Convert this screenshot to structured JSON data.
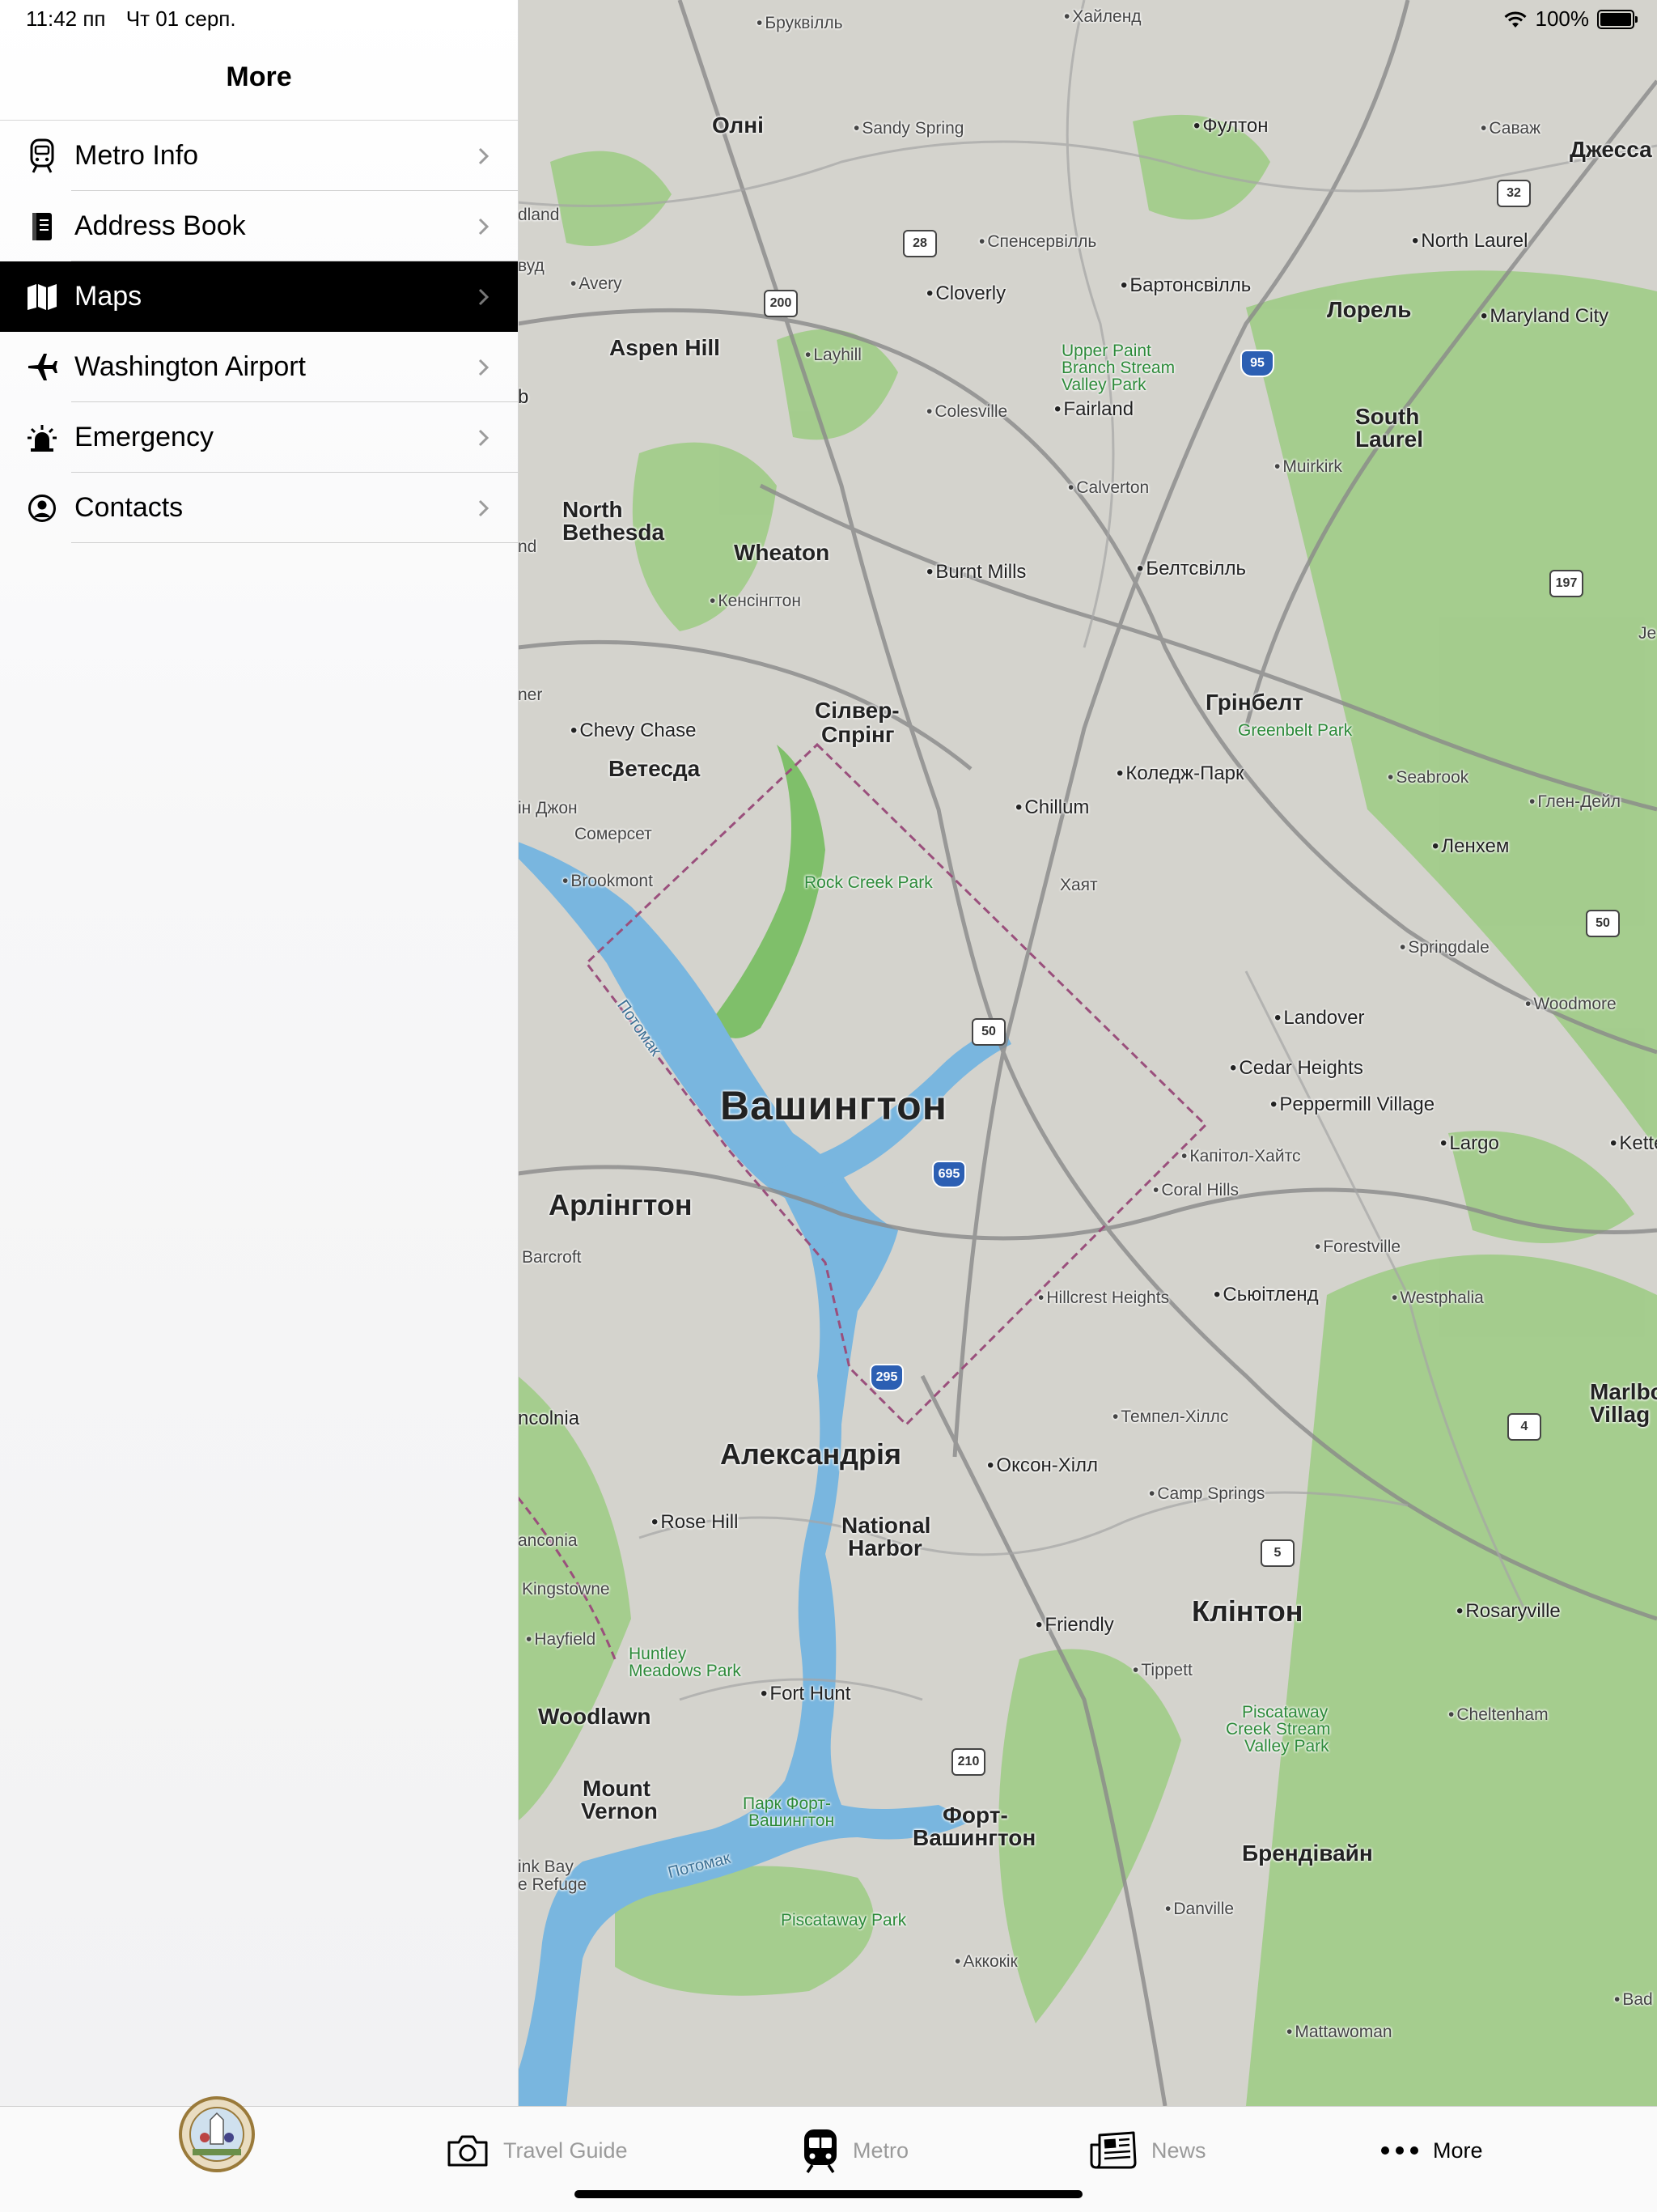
{
  "status_bar": {
    "time": "11:42 пп",
    "date": "Чт 01 серп.",
    "battery": "100%",
    "icons": [
      "wifi-icon",
      "battery-icon"
    ]
  },
  "sidebar": {
    "title": "More",
    "items": [
      {
        "label": "Metro Info",
        "icon": "train-icon"
      },
      {
        "label": "Address Book",
        "icon": "address-book-icon"
      },
      {
        "label": "Maps",
        "icon": "map-icon",
        "selected": true
      },
      {
        "label": "Washington Airport",
        "icon": "airplane-icon"
      },
      {
        "label": "Emergency",
        "icon": "siren-icon"
      },
      {
        "label": "Contacts",
        "icon": "person-circle-icon"
      }
    ]
  },
  "map": {
    "labels": {
      "brukvill": "Бруквілль",
      "khailend": "Хайленд",
      "olni": "Олні",
      "sandy_spring": "Sandy Spring",
      "fulton": "Фултон",
      "savazh": "Саваж",
      "jessup": "Джесса",
      "dland": "dland",
      "spensersville": "Спенсервілль",
      "north_laurel": "North Laurel",
      "vud": "вуд",
      "avery": "Avery",
      "cloverly": "Cloverly",
      "burtonsville": "Бартонсвілль",
      "laurel": "Лорель",
      "maryland_city": "Maryland City",
      "aspen_hill": "Aspen Hill",
      "layhill": "Layhill",
      "upper_paint": "Upper Paint",
      "branch_stream": "Branch Stream",
      "valley_park": "Valley Park",
      "colesville": "Colesville",
      "fairland": "Fairland",
      "south_laurel": "South",
      "south_laurel_2": "Laurel",
      "muirkirk": "Muirkirk",
      "b": "b",
      "calverton": "Calverton",
      "north_bethesda": "North",
      "north_bethesda_2": "Bethesda",
      "rock_creek": "Rock Creek",
      "nd": "nd",
      "wheaton": "Wheaton",
      "burnt_mills": "Burnt Mills",
      "beltsville": "Белтсвілль",
      "je": "Je",
      "kensington": "Кенсінгтон",
      "ner": "ner",
      "greenbelt": "Грінбелт",
      "greenbelt_park": "Greenbelt Park",
      "silver_spring": "Сілвер-",
      "silver_spring_2": "Спрінг",
      "chevy_chase": "Chevy Chase",
      "bethesda": "Ветесда",
      "college_park": "Коледж-Парк",
      "seabrook": "Seabrook",
      "ih_john": "ін Джон",
      "chillum": "Chillum",
      "glenn_dale": "Глен-Дейл",
      "somerset": "Сомерсет",
      "lanham": "Ленхем",
      "brookmont": "Brookmont",
      "rock_creek_park": "Rock Creek Park",
      "hyattsville": "Хаят",
      "springdale": "Springdale",
      "potomac_1": "Потомак",
      "landover": "Landover",
      "woodmore": "Woodmore",
      "cedar_heights": "Cedar Heights",
      "peppermill": "Peppermill Village",
      "washington": "Вашингтон",
      "largo": "Largo",
      "ketteri": "Ketteri",
      "capitol_heights": "Капітол-Хайтс",
      "arlington": "Арлінгтон",
      "coral_hills": "Coral Hills",
      "barcroft": "Barcroft",
      "forestville": "Forestville",
      "hillcrest": "Hillcrest Heights",
      "suitland": "Сьюітленд",
      "westphalia": "Westphalia",
      "ncolnia": "ncolnia",
      "temple_hills": "Темпел-Хіллс",
      "marlbo": "Marlbo",
      "marlbo_2": "Villag",
      "alexandria": "Александрія",
      "oxon_hill": "Оксон-Хілл",
      "camp_springs": "Camp Springs",
      "rose_hill": "Rose Hill",
      "national_harbor": "National",
      "national_harbor_2": "Harbor",
      "anconia": "anconia",
      "kingstowne": "Kingstowne",
      "clinton": "Клінтон",
      "rosaryville": "Rosaryville",
      "hayfield": "Hayfield",
      "huntley": "Huntley",
      "huntley_2": "Meadows Park",
      "friendly": "Friendly",
      "tippett": "Tippett",
      "fort_hunt": "Fort Hunt",
      "piscataway_creek": "Piscataway",
      "piscataway_creek_2": "Creek Stream",
      "piscataway_creek_3": "Valley Park",
      "cheltenham": "Cheltenham",
      "woodlawn": "Woodlawn",
      "mount_vernon": "Mount",
      "mount_vernon_2": "Vernon",
      "fort_wash_park": "Парк Форт-",
      "fort_wash_park_2": "Вашингтон",
      "fort_washington": "Форт-",
      "fort_washington_2": "Вашингтон",
      "brandywine": "Брендівайн",
      "ink_bay": "ink Bay",
      "ink_bay_2": "e Refuge",
      "potomac_2": "Потомак",
      "piscataway_park": "Piscataway Park",
      "danville": "Danville",
      "accokeek": "Аккокік",
      "bad": "Bad",
      "mattawoman": "Mattawoman"
    },
    "shields": {
      "r28": "28",
      "r200": "200",
      "r32": "32",
      "i95": "95",
      "r197": "197",
      "r50a": "50",
      "r50b": "50",
      "i695": "695",
      "i295": "295",
      "r4": "4",
      "r5": "5",
      "r210": "210"
    }
  },
  "tabbar": {
    "tabs": [
      {
        "label": "",
        "icon": "seal-icon"
      },
      {
        "label": "Travel Guide",
        "icon": "camera-icon"
      },
      {
        "label": "Metro",
        "icon": "metro-icon"
      },
      {
        "label": "News",
        "icon": "newspaper-icon"
      },
      {
        "label": "More",
        "icon": "ellipsis-icon",
        "selected": true
      }
    ]
  },
  "colors": {
    "selected_row": "#000000",
    "park_green": "#9ccb83",
    "water_blue": "#79b6df",
    "land": "#d4d3cd",
    "road": "#8c8c8c",
    "dc_boundary": "#9a4f7c"
  }
}
